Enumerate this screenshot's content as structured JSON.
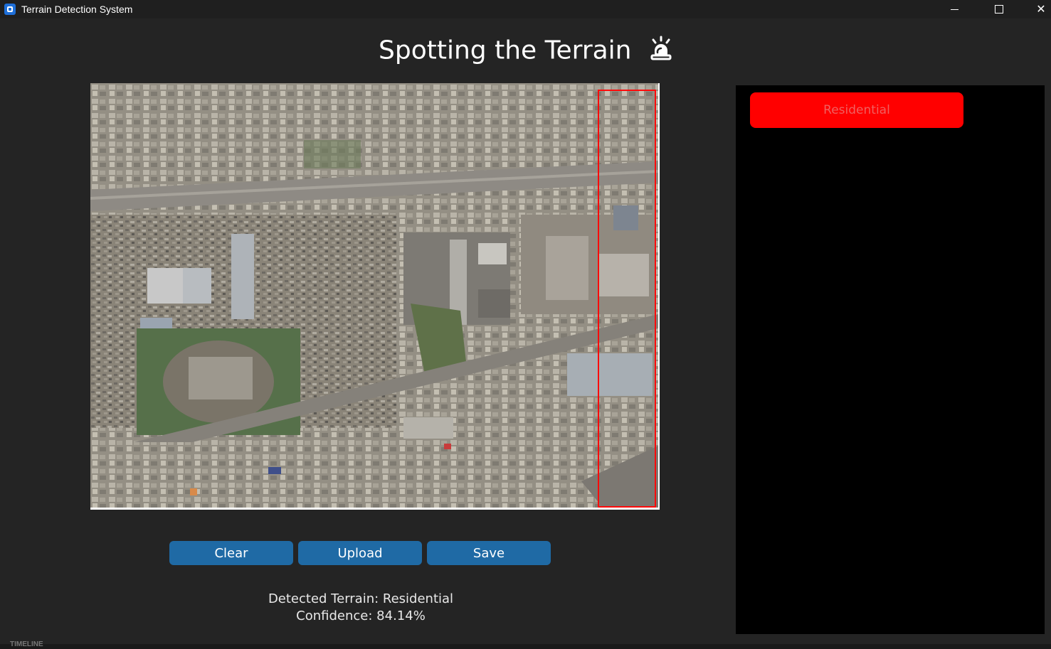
{
  "window": {
    "title": "Terrain Detection System",
    "icon": "app-icon"
  },
  "header": {
    "title": "Spotting the Terrain",
    "icon": "siren-icon"
  },
  "image_panel": {
    "image": "aerial-satellite-image",
    "detection_label": "Residential",
    "detection_color": "#ff0000"
  },
  "buttons": {
    "clear": "Clear",
    "upload": "Upload",
    "save": "Save",
    "color": "#1f6aa5"
  },
  "results": {
    "terrain": "Detected Terrain: Residential",
    "confidence": "Confidence: 84.14%"
  },
  "side_panel": {
    "chip_label": "Residential",
    "chip_color": "#ff0000"
  },
  "bottom_strip": {
    "text": "TIMELINE"
  }
}
